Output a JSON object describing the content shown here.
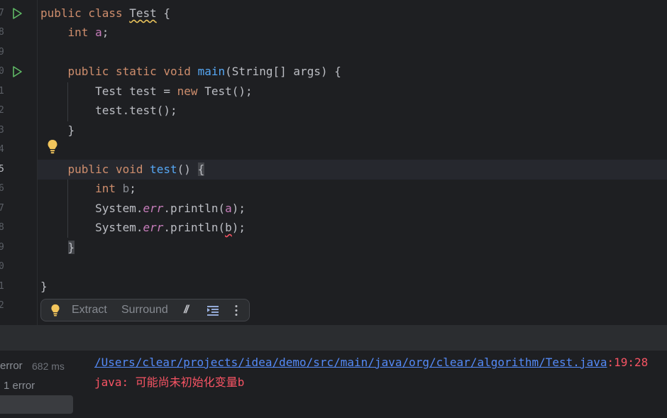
{
  "editor": {
    "line_numbers": [
      "7",
      "8",
      "9",
      "0",
      "1",
      "2",
      "3",
      "4",
      "5",
      "6",
      "7",
      "8",
      "9",
      "0",
      "1",
      "2"
    ],
    "code": {
      "l7": [
        "public class ",
        "Test",
        " {"
      ],
      "l8": [
        "    ",
        "int",
        " ",
        "a",
        ";"
      ],
      "l10": [
        "    ",
        "public static void ",
        "main",
        "(String[] args) {"
      ],
      "l11": [
        "        Test test = ",
        "new",
        " Test();"
      ],
      "l12": [
        "        test.test();"
      ],
      "l13": [
        "    }"
      ],
      "l15": [
        "    ",
        "public void ",
        "test",
        "() ",
        "{"
      ],
      "l16": [
        "        ",
        "int",
        " ",
        "b",
        ";"
      ],
      "l17": [
        "        System.",
        "err",
        ".println(",
        "a",
        ");"
      ],
      "l18": [
        "        System.",
        "err",
        ".println(",
        "b",
        ");"
      ],
      "l19": [
        "    ",
        "}"
      ],
      "l21": [
        "}"
      ]
    },
    "gutter_icons": [
      "run-icon",
      "run-icon",
      "lightbulb-icon"
    ]
  },
  "intention_bar": {
    "extract": "Extract",
    "surround": "Surround",
    "comment_glyph": "//",
    "icons": [
      "lightbulb-icon",
      "comment-icon",
      "reformat-icon",
      "more-icon"
    ]
  },
  "console": {
    "build_status": "error",
    "build_time": "682 ms",
    "error_count": "1 error",
    "error_path": "/Users/clear/projects/idea/demo/src/main/java/org/clear/algorithm/Test.java",
    "error_location": ":19:28",
    "error_message": "java: 可能尚未初始化变量b"
  },
  "colors": {
    "background": "#1e1f22",
    "keyword": "#cf8e6d",
    "function": "#56a8f5",
    "field": "#c77dbb",
    "link": "#548af7",
    "error": "#f75464"
  }
}
